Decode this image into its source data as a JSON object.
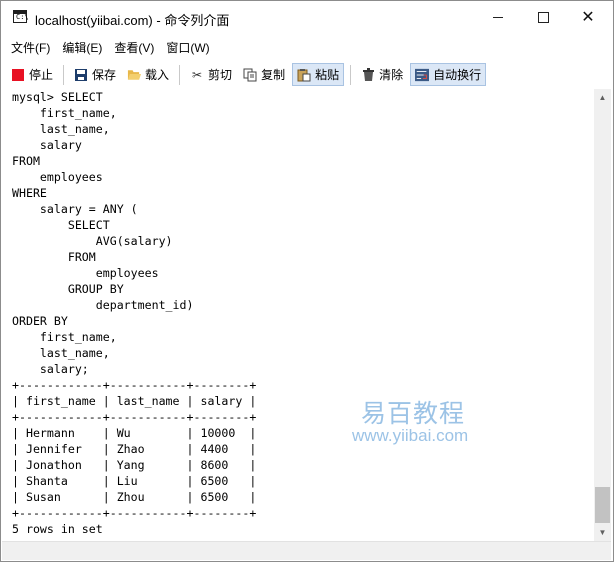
{
  "window": {
    "title": "localhost(yiibai.com) - 命令列介面",
    "app_icon_text": "C:\\"
  },
  "menubar": {
    "items": [
      "文件(F)",
      "编辑(E)",
      "查看(V)",
      "窗口(W)"
    ]
  },
  "toolbar": {
    "stop": "停止",
    "save": "保存",
    "load": "载入",
    "cut": "剪切",
    "copy": "复制",
    "paste": "粘贴",
    "clear": "清除",
    "wrap": "自动换行"
  },
  "console": {
    "text": "mysql> SELECT\n    first_name,\n    last_name,\n    salary\nFROM\n    employees\nWHERE\n    salary = ANY (\n        SELECT\n            AVG(salary)\n        FROM\n            employees\n        GROUP BY\n            department_id)\nORDER BY\n    first_name,\n    last_name,\n    salary;\n+------------+-----------+--------+\n| first_name | last_name | salary |\n+------------+-----------+--------+\n| Hermann    | Wu        | 10000  |\n| Jennifer   | Zhao      | 4400   |\n| Jonathon   | Yang      | 8600   |\n| Shanta     | Liu       | 6500   |\n| Susan      | Zhou      | 6500   |\n+------------+-----------+--------+\n5 rows in set"
  },
  "watermark": {
    "brand": "易百教程",
    "url": "www.yiibai.com"
  },
  "icons": {
    "stop": "stop-icon",
    "save": "save-icon",
    "load": "folder-open-icon",
    "cut": "scissors-icon",
    "copy": "copy-icon",
    "paste": "paste-icon",
    "clear": "trash-icon",
    "wrap": "word-wrap-icon"
  },
  "colors": {
    "stop_red": "#e81123",
    "pressed_bg": "#dbe7f6",
    "watermark": "#9cc3e6"
  }
}
